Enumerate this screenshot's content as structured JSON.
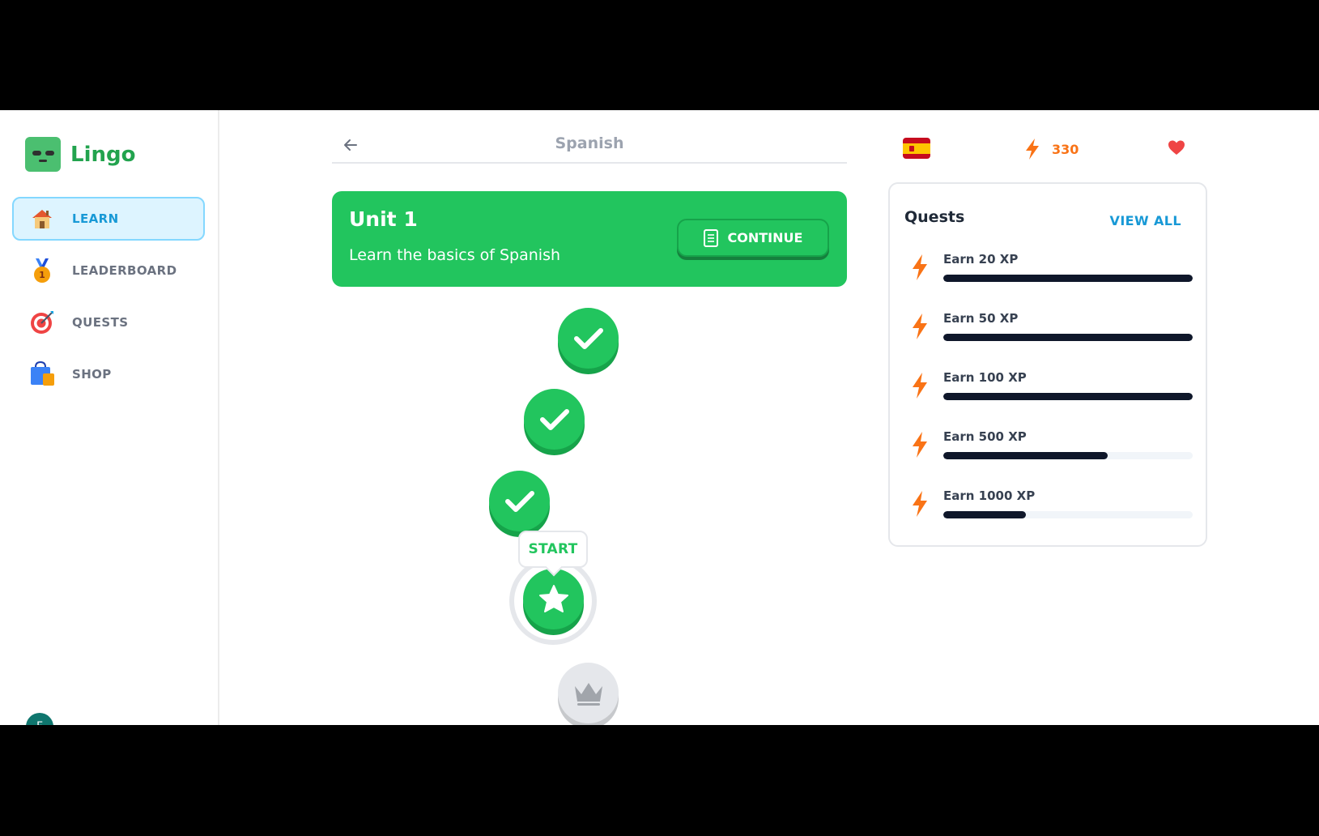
{
  "app": {
    "name": "Lingo"
  },
  "sidebar": {
    "items": [
      {
        "label": "LEARN",
        "icon": "house-icon",
        "active": true
      },
      {
        "label": "LEADERBOARD",
        "icon": "medal-icon",
        "active": false
      },
      {
        "label": "QUESTS",
        "icon": "target-icon",
        "active": false
      },
      {
        "label": "SHOP",
        "icon": "shopping-bag-icon",
        "active": false
      }
    ],
    "avatar_initial": "F"
  },
  "header": {
    "title": "Spanish"
  },
  "unit": {
    "title": "Unit 1",
    "description": "Learn the basics of Spanish",
    "continue_label": "CONTINUE"
  },
  "lessons": [
    {
      "status": "completed",
      "icon": "check-icon"
    },
    {
      "status": "completed",
      "icon": "check-icon"
    },
    {
      "status": "completed",
      "icon": "check-icon"
    },
    {
      "status": "current",
      "icon": "star-icon",
      "bubble": "START"
    },
    {
      "status": "locked",
      "icon": "crown-icon"
    }
  ],
  "stats": {
    "language_flag": "spain-flag-icon",
    "xp": "330",
    "hearts_icon": "heart-icon"
  },
  "quests": {
    "title": "Quests",
    "view_all": "VIEW ALL",
    "items": [
      {
        "label": "Earn 20 XP",
        "progress": 1.0
      },
      {
        "label": "Earn 50 XP",
        "progress": 1.0
      },
      {
        "label": "Earn 100 XP",
        "progress": 1.0
      },
      {
        "label": "Earn 500 XP",
        "progress": 0.66
      },
      {
        "label": "Earn 1000 XP",
        "progress": 0.33
      }
    ]
  },
  "colors": {
    "primary_green": "#22c55e",
    "accent_blue": "#1899d6",
    "xp_orange": "#f97316",
    "progress_dark": "#0f172a"
  }
}
